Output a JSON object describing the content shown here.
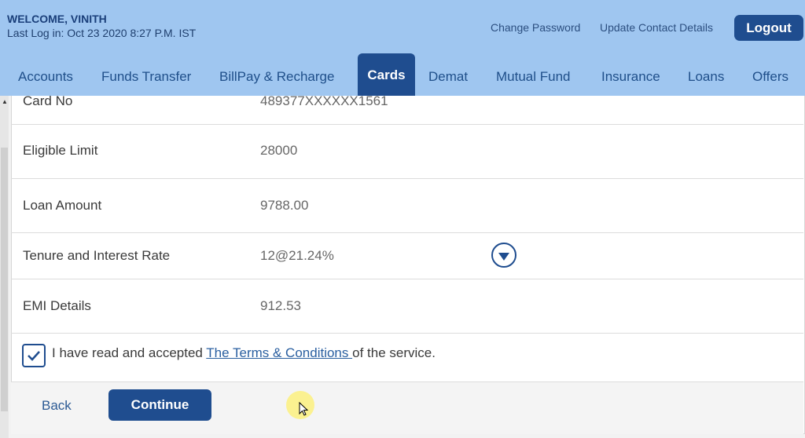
{
  "header": {
    "welcome": "WELCOME, VINITH",
    "last_login": "Last Log in: Oct 23 2020 8:27 P.M. IST",
    "change_password": "Change Password",
    "update_contact": "Update Contact Details",
    "logout": "Logout"
  },
  "nav": {
    "items": [
      "Accounts",
      "Funds Transfer",
      "BillPay & Recharge",
      "Cards",
      "Demat",
      "Mutual Fund",
      "Insurance",
      "Loans",
      "Offers"
    ],
    "active": "Cards"
  },
  "form": {
    "rows": [
      {
        "label": "Card No",
        "value": "489377XXXXXX1561"
      },
      {
        "label": "Eligible Limit",
        "value": "28000"
      },
      {
        "label": "Loan Amount",
        "value": "9788.00"
      },
      {
        "label": "Tenure and Interest Rate",
        "value": "12@21.24%"
      },
      {
        "label": "EMI Details",
        "value": "912.53"
      }
    ],
    "terms_prefix": "I have read and accepted ",
    "terms_link": "The Terms & Conditions ",
    "terms_suffix": "of the service.",
    "terms_checked": true
  },
  "actions": {
    "back": "Back",
    "continue": "Continue"
  },
  "colors": {
    "header_bg": "#9fc6f0",
    "accent": "#1f4d8f"
  }
}
